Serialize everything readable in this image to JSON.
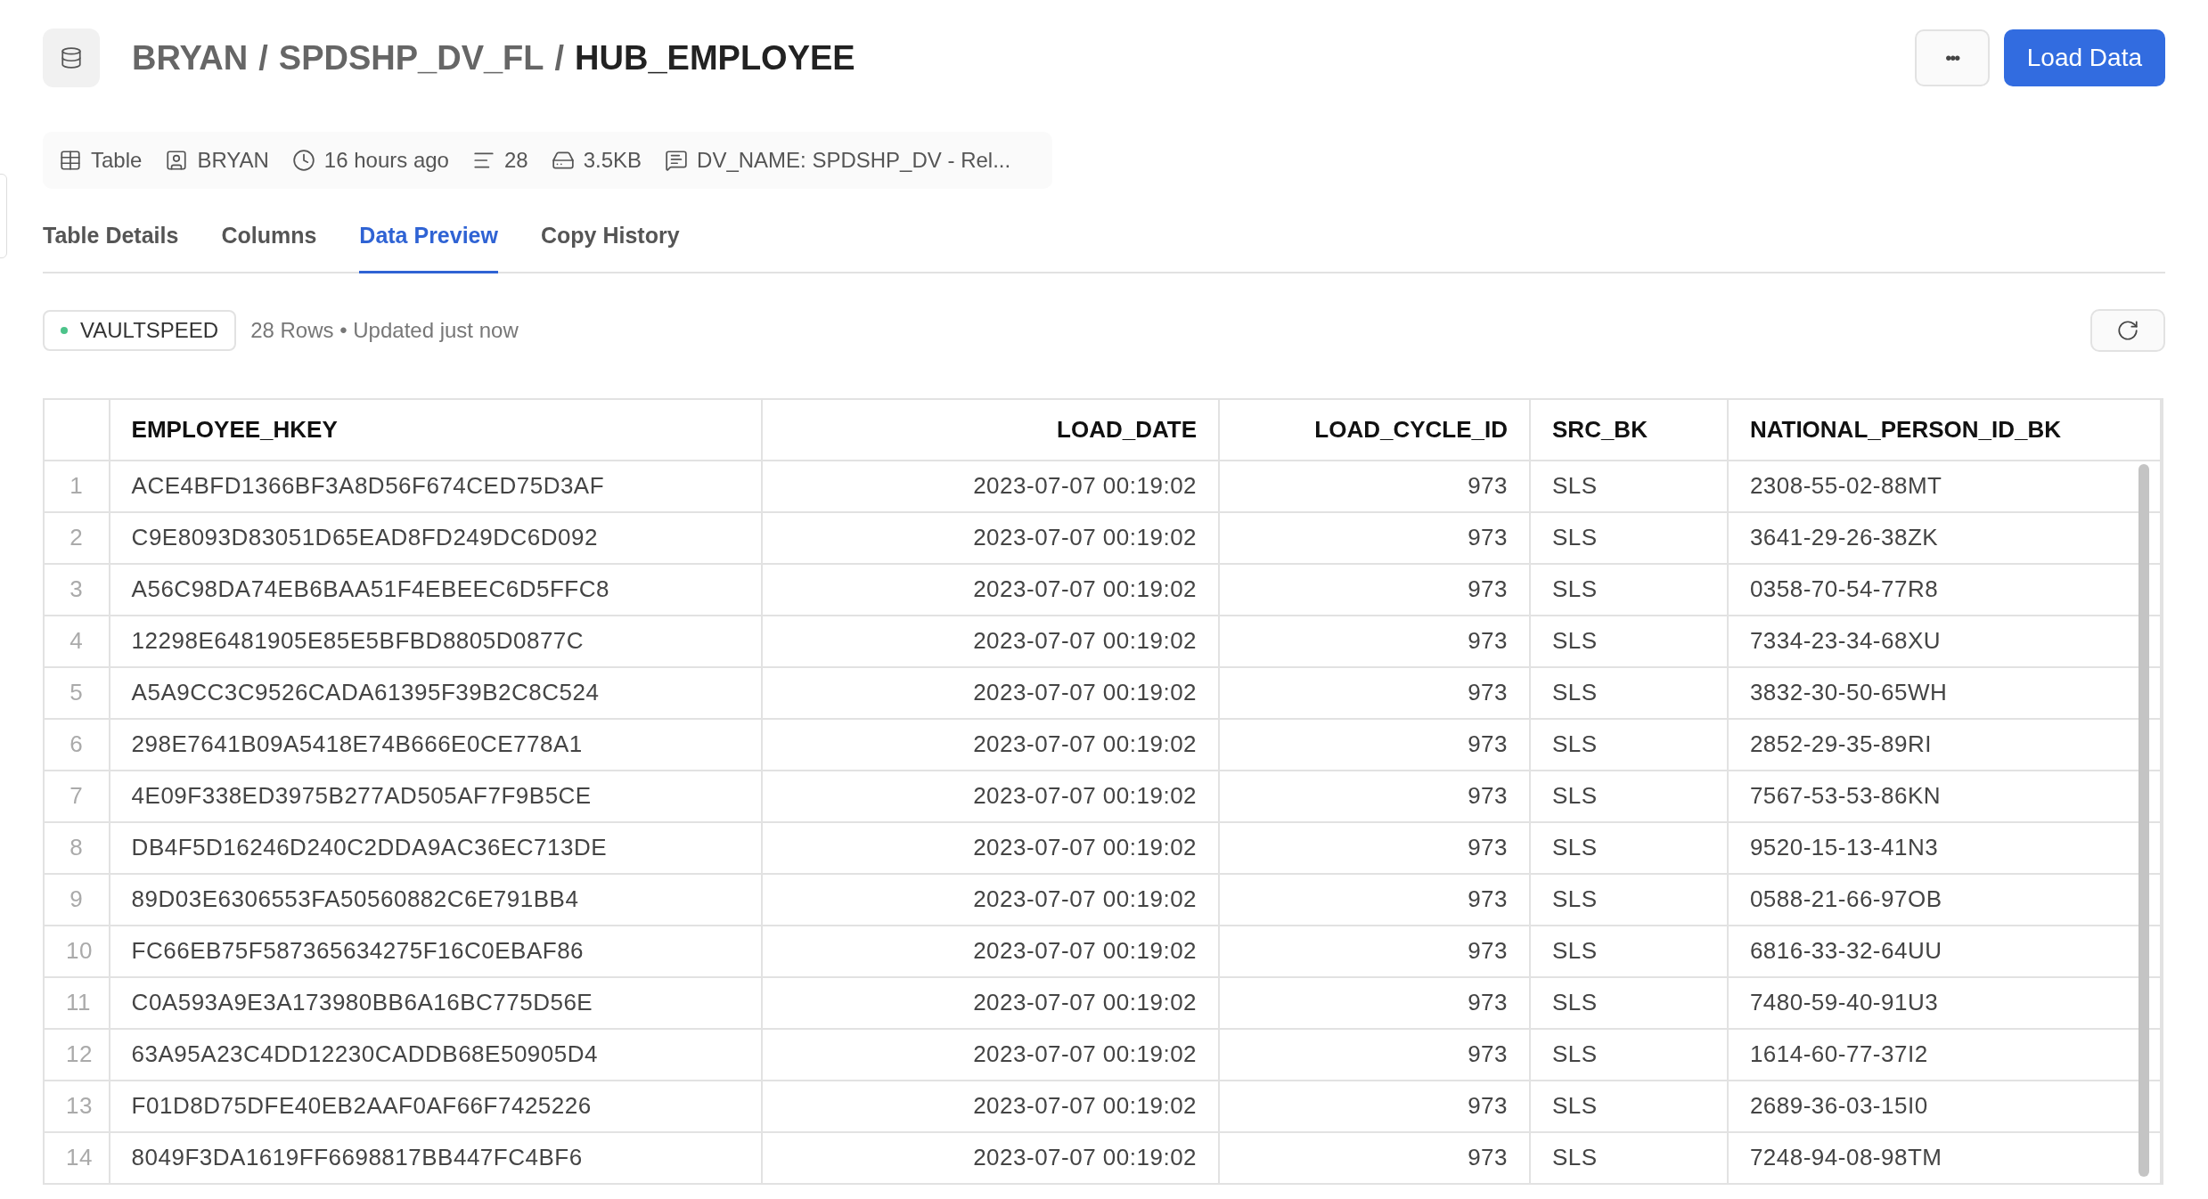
{
  "breadcrumb": [
    {
      "label": "BRYAN",
      "current": false
    },
    {
      "label": "SPDSHP_DV_FL",
      "current": false
    },
    {
      "label": "HUB_EMPLOYEE",
      "current": true
    }
  ],
  "separator": "/",
  "more_button": "•••",
  "load_button": "Load Data",
  "meta": [
    {
      "kind": "table",
      "text": "Table"
    },
    {
      "kind": "owner",
      "text": "BRYAN"
    },
    {
      "kind": "time",
      "text": "16 hours ago"
    },
    {
      "kind": "rows",
      "text": "28"
    },
    {
      "kind": "size",
      "text": "3.5KB"
    },
    {
      "kind": "comment",
      "text": "DV_NAME: SPDSHP_DV - Rel..."
    }
  ],
  "tabs": [
    {
      "label": "Table Details",
      "selected": false
    },
    {
      "label": "Columns",
      "selected": false
    },
    {
      "label": "Data Preview",
      "selected": true
    },
    {
      "label": "Copy History",
      "selected": false
    }
  ],
  "source_tag": {
    "label": "VAULTSPEED",
    "color": "#4cc38a"
  },
  "status": "28 Rows • Updated just now",
  "table": {
    "columns": [
      "",
      "EMPLOYEE_HKEY",
      "LOAD_DATE",
      "LOAD_CYCLE_ID",
      "SRC_BK",
      "NATIONAL_PERSON_ID_BK"
    ],
    "rows": [
      [
        "1",
        "ACE4BFD1366BF3A8D56F674CED75D3AF",
        "2023-07-07 00:19:02",
        "973",
        "SLS",
        "2308-55-02-88MT"
      ],
      [
        "2",
        "C9E8093D83051D65EAD8FD249DC6D092",
        "2023-07-07 00:19:02",
        "973",
        "SLS",
        "3641-29-26-38ZK"
      ],
      [
        "3",
        "A56C98DA74EB6BAA51F4EBEEC6D5FFC8",
        "2023-07-07 00:19:02",
        "973",
        "SLS",
        "0358-70-54-77R8"
      ],
      [
        "4",
        "12298E6481905E85E5BFBD8805D0877C",
        "2023-07-07 00:19:02",
        "973",
        "SLS",
        "7334-23-34-68XU"
      ],
      [
        "5",
        "A5A9CC3C9526CADA61395F39B2C8C524",
        "2023-07-07 00:19:02",
        "973",
        "SLS",
        "3832-30-50-65WH"
      ],
      [
        "6",
        "298E7641B09A5418E74B666E0CE778A1",
        "2023-07-07 00:19:02",
        "973",
        "SLS",
        "2852-29-35-89RI"
      ],
      [
        "7",
        "4E09F338ED3975B277AD505AF7F9B5CE",
        "2023-07-07 00:19:02",
        "973",
        "SLS",
        "7567-53-53-86KN"
      ],
      [
        "8",
        "DB4F5D16246D240C2DDA9AC36EC713DE",
        "2023-07-07 00:19:02",
        "973",
        "SLS",
        "9520-15-13-41N3"
      ],
      [
        "9",
        "89D03E6306553FA50560882C6E791BB4",
        "2023-07-07 00:19:02",
        "973",
        "SLS",
        "0588-21-66-97OB"
      ],
      [
        "10",
        "FC66EB75F587365634275F16C0EBAF86",
        "2023-07-07 00:19:02",
        "973",
        "SLS",
        "6816-33-32-64UU"
      ],
      [
        "11",
        "C0A593A9E3A173980BB6A16BC775D56E",
        "2023-07-07 00:19:02",
        "973",
        "SLS",
        "7480-59-40-91U3"
      ],
      [
        "12",
        "63A95A23C4DD12230CADDB68E50905D4",
        "2023-07-07 00:19:02",
        "973",
        "SLS",
        "1614-60-77-37I2"
      ],
      [
        "13",
        "F01D8D75DFE40EB2AAF0AF66F7425226",
        "2023-07-07 00:19:02",
        "973",
        "SLS",
        "2689-36-03-15I0"
      ],
      [
        "14",
        "8049F3DA1619FF6698817BB447FC4BF6",
        "2023-07-07 00:19:02",
        "973",
        "SLS",
        "7248-94-08-98TM"
      ]
    ]
  }
}
